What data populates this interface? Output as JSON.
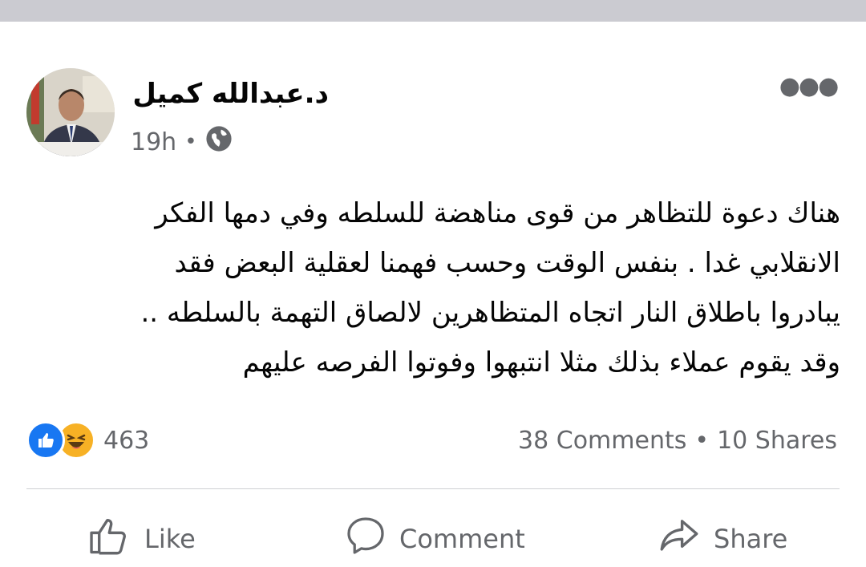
{
  "post": {
    "author": "د.عبدالله كميل",
    "timestamp": "19h",
    "audience_icon": "globe-icon",
    "more_icon": "more-options-icon",
    "text_lines": [
      "هناك دعوة للتظاهر من قوى مناهضة للسلطه وفي دمها الفكر",
      "الانقلابي غدا . بنفس الوقت وحسب فهمنا لعقلية البعض فقد",
      "يبادروا باطلاق النار اتجاه المتظاهرين لالصاق التهمة بالسلطه ..",
      "وقد يقوم عملاء بذلك مثلا انتبهوا وفوتوا الفرصه عليهم"
    ]
  },
  "reactions": {
    "icons": [
      "like-reaction-icon",
      "haha-reaction-icon"
    ],
    "count": "463",
    "colors": {
      "like": "#1877f2",
      "haha": "#f7b125"
    }
  },
  "stats": {
    "comments": "38 Comments",
    "separator": "•",
    "shares": "10 Shares"
  },
  "actions": {
    "like": "Like",
    "comment": "Comment",
    "share": "Share"
  }
}
